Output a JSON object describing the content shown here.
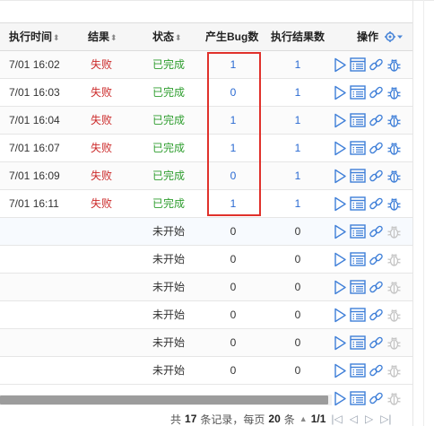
{
  "colors": {
    "fail": "#cc2b2b",
    "done": "#2f9e2f",
    "link": "#2a6ad2",
    "highlight": "#e0312b"
  },
  "header": {
    "exec_time": "执行时间",
    "result": "结果",
    "status": "状态",
    "bugs": "产生Bug数",
    "exec_results": "执行结果数",
    "actions": "操作",
    "sort_glyph": "⬍"
  },
  "rows": [
    {
      "time": "7/01 16:02",
      "result": "失败",
      "status": "已完成",
      "bugs": "1",
      "exec": "1"
    },
    {
      "time": "7/01 16:03",
      "result": "失败",
      "status": "已完成",
      "bugs": "0",
      "exec": "1"
    },
    {
      "time": "7/01 16:04",
      "result": "失败",
      "status": "已完成",
      "bugs": "1",
      "exec": "1"
    },
    {
      "time": "7/01 16:07",
      "result": "失败",
      "status": "已完成",
      "bugs": "1",
      "exec": "1"
    },
    {
      "time": "7/01 16:09",
      "result": "失败",
      "status": "已完成",
      "bugs": "0",
      "exec": "1"
    },
    {
      "time": "7/01 16:11",
      "result": "失败",
      "status": "已完成",
      "bugs": "1",
      "exec": "1"
    },
    {
      "time": "",
      "result": "",
      "status": "未开始",
      "bugs": "0",
      "exec": "0"
    },
    {
      "time": "",
      "result": "",
      "status": "未开始",
      "bugs": "0",
      "exec": "0"
    },
    {
      "time": "",
      "result": "",
      "status": "未开始",
      "bugs": "0",
      "exec": "0"
    },
    {
      "time": "",
      "result": "",
      "status": "未开始",
      "bugs": "0",
      "exec": "0"
    },
    {
      "time": "",
      "result": "",
      "status": "未开始",
      "bugs": "0",
      "exec": "0"
    },
    {
      "time": "",
      "result": "",
      "status": "未开始",
      "bugs": "0",
      "exec": "0"
    }
  ],
  "row_icons": [
    "run-icon",
    "results-list-icon",
    "link-icon",
    "bug-icon"
  ],
  "pager": {
    "total_prefix": "共",
    "total": "17",
    "total_suffix": "条记录，每页",
    "per_page": "20",
    "per_page_suffix": "条",
    "page": "1/1"
  }
}
